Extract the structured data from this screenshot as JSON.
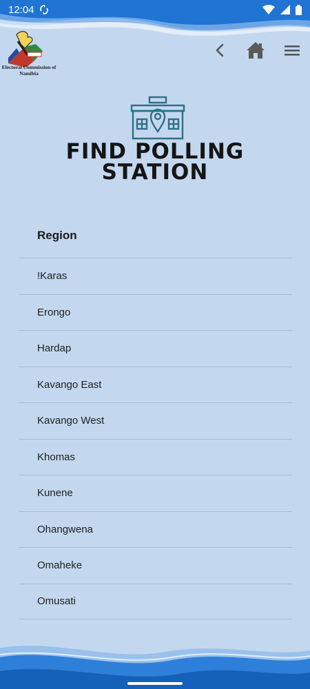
{
  "status_bar": {
    "time": "12:04"
  },
  "header": {
    "logo_caption": "Electoral Commission of Namibia",
    "icons": {
      "back": "chevron-left-icon",
      "home": "home-icon",
      "menu": "hamburger-menu-icon"
    }
  },
  "hero": {
    "title_line1": "FIND POLLING",
    "title_line2": "STATION",
    "icon": "polling-station-icon"
  },
  "list": {
    "header": "Region",
    "items": [
      "!Karas",
      "Erongo",
      "Hardap",
      "Kavango East",
      "Kavango West",
      "Khomas",
      "Kunene",
      "Ohangwena",
      "Omaheke",
      "Omusati"
    ]
  },
  "colors": {
    "background": "#c3d8ef",
    "accent": "#1e6fd0",
    "icon_teal": "#2f6f86"
  }
}
